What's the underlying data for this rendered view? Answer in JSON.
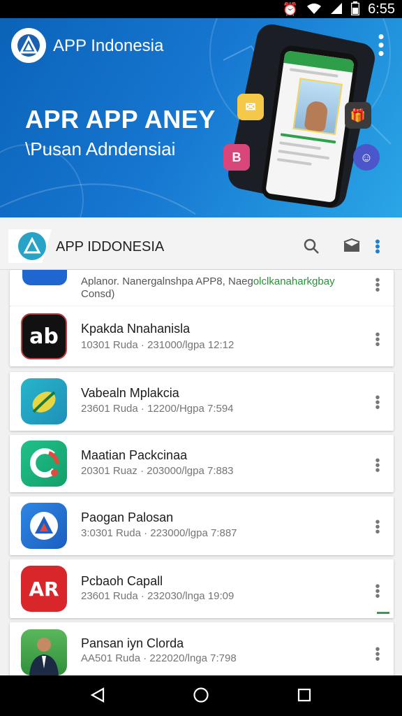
{
  "status_bar": {
    "time": "6:55",
    "icons": [
      "alarm-icon",
      "wifi-icon",
      "signal-icon",
      "battery-icon"
    ]
  },
  "hero": {
    "app_name": "APP Indonesia",
    "headline": "APR APP ANEY",
    "subheadline": "\\Pusan Adndensiai"
  },
  "app_bar": {
    "title": "APP IDDONESIA",
    "icons": [
      "search-icon",
      "inbox-icon",
      "overflow-menu-icon"
    ]
  },
  "list": {
    "partial_item": {
      "text_prefix": "Aplanor. Nanergalnshpa APP8, Naeg",
      "text_green": "olclkanaharkgbay",
      "text_line2": "Consd)"
    },
    "items": [
      {
        "title": "Kpakda Nnahanisla",
        "meta": "10301 Ruda · 231000/lgpa 12:12",
        "icon": "ab-logo-icon"
      },
      {
        "title": "Vabealn Mplakcia",
        "meta": "23601 Ruda · 12200/Hgpa 7:594",
        "icon": "leaf-logo-icon"
      },
      {
        "title": "Maatian Packcinaa",
        "meta": "20301 Ruaz · 203000/lgpa 7:883",
        "icon": "hook-logo-icon"
      },
      {
        "title": "Paogan Palosan",
        "meta": "3:0301 Ruda · 223000/lgpa 7:887",
        "icon": "triangle-logo-icon"
      },
      {
        "title": "Pcbaoh Capall",
        "meta": "23601 Ruda · 232030/lnga 19:09",
        "icon": "ar-logo-icon"
      },
      {
        "title": "Pansan iyn Clorda",
        "meta": "AA501 Ruda · 222020/lnga 7:798",
        "icon": "portrait-icon"
      }
    ]
  },
  "colors": {
    "hero_start": "#0b63b8",
    "hero_end": "#2aa6e6",
    "accent_green": "#2ea24a"
  }
}
